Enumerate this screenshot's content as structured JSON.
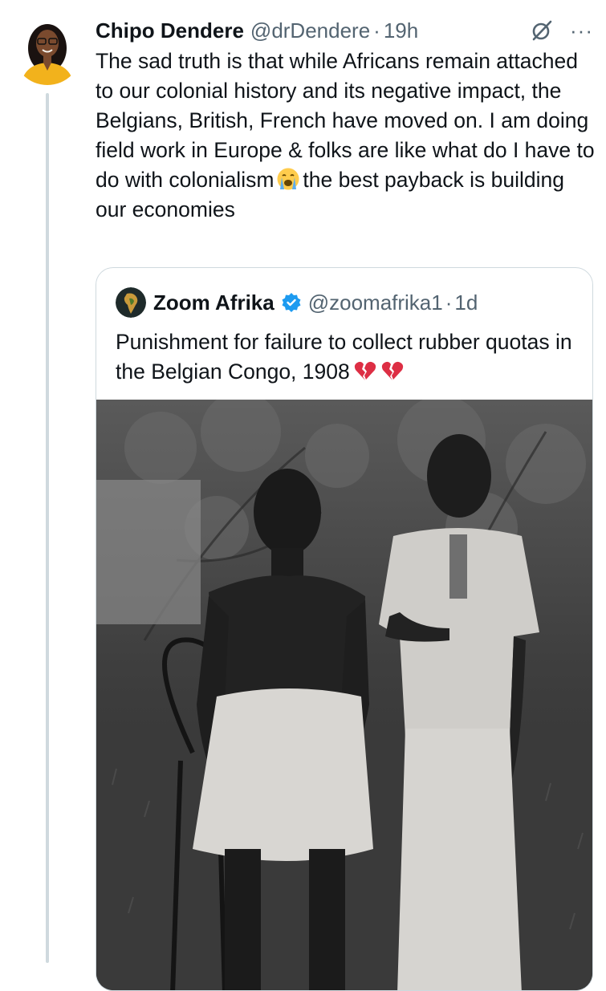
{
  "tweet": {
    "author_name": "Chipo Dendere",
    "author_handle": "@drDendere",
    "separator": "·",
    "timestamp": "19h",
    "text_part1": "The sad truth is that while Africans remain attached to our colonial history and its negative impact, the Belgians, British, French have moved on.  I am doing field work in Europe & folks are like what do I have to do with colonialism",
    "text_emoji": "loudly-crying-face-emoji",
    "text_part2": "the best payback is building our economies",
    "more_icon": "more-options-icon",
    "grok_icon": "grok-icon"
  },
  "quote": {
    "author_name": "Zoom Afrika",
    "author_handle": "@zoomafrika1",
    "separator": "·",
    "timestamp": "1d",
    "text": "Punishment for failure to collect rubber quotas in the Belgian Congo, 1908",
    "text_emojis": [
      "broken-heart-emoji",
      "broken-heart-emoji"
    ],
    "verified_icon": "verified-badge-icon",
    "image_alt": "black-and-white historical photograph of two children"
  },
  "colors": {
    "text": "#0f1419",
    "secondary": "#536471",
    "border": "#cfd9de",
    "verified": "#1d9bf0"
  }
}
